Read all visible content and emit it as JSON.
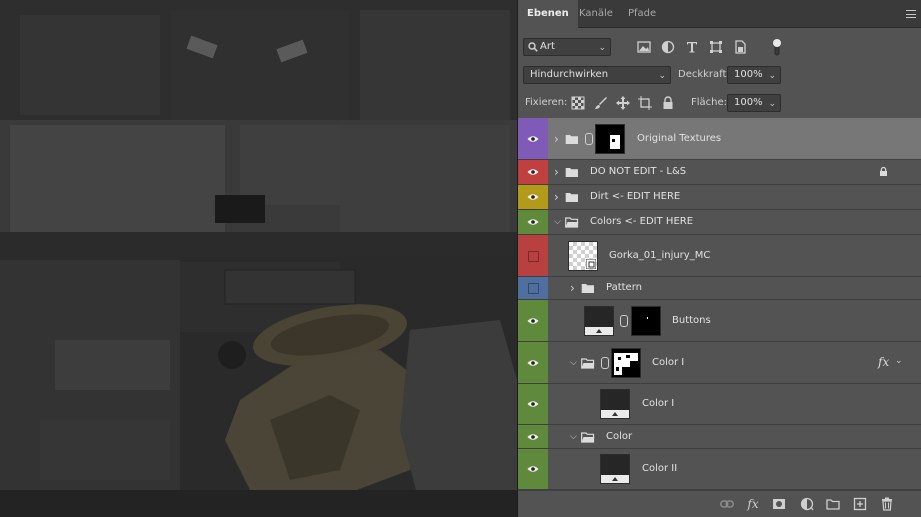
{
  "tabs": [
    {
      "label": "Ebenen",
      "active": true
    },
    {
      "label": "Kanäle",
      "active": false
    },
    {
      "label": "Pfade",
      "active": false
    }
  ],
  "filter": {
    "kind_value": "Art"
  },
  "blend": {
    "mode_value": "Hindurchwirken",
    "opacity_label": "Deckkraft:",
    "opacity_value": "100%"
  },
  "lock_row": {
    "lock_label": "Fixieren:",
    "fill_label": "Fläche:",
    "fill_value": "100%"
  },
  "layers": [
    {
      "name": "Original Textures",
      "color": "#7f5ab7",
      "visible": true,
      "type": "group-mask",
      "selected": true
    },
    {
      "name": "DO NOT EDIT  - L&S",
      "color": "#c0403f",
      "visible": true,
      "type": "group",
      "locked": true
    },
    {
      "name": "Dirt <- EDIT HERE",
      "color": "#b39a18",
      "visible": true,
      "type": "group"
    },
    {
      "name": "Colors <- EDIT HERE",
      "color": "#5f8a3c",
      "visible": true,
      "type": "group-open"
    },
    {
      "name": "Gorka_01_injury_MC",
      "color": "#b8403e",
      "visible": false,
      "type": "smart"
    },
    {
      "name": "Pattern",
      "color": "#4e6f9f",
      "visible": false,
      "type": "group"
    },
    {
      "name": "Buttons",
      "color": "#5f8a3c",
      "visible": true,
      "type": "fill-mask"
    },
    {
      "name": "Color I",
      "color": "#5f8a3c",
      "visible": true,
      "type": "group-open-mask",
      "fx": "fx"
    },
    {
      "name": "Color I",
      "color": "#5f8a3c",
      "visible": true,
      "type": "fill"
    },
    {
      "name": "Color",
      "color": "#5f8a3c",
      "visible": true,
      "type": "group-open"
    },
    {
      "name": "Color II",
      "color": "#5f8a3c",
      "visible": true,
      "type": "fill"
    }
  ],
  "bottom_icons": [
    "link-icon",
    "fx-icon",
    "mask-icon",
    "adjustment-icon",
    "new-group-icon",
    "new-layer-icon",
    "trash-icon"
  ],
  "fx_label": "fx"
}
